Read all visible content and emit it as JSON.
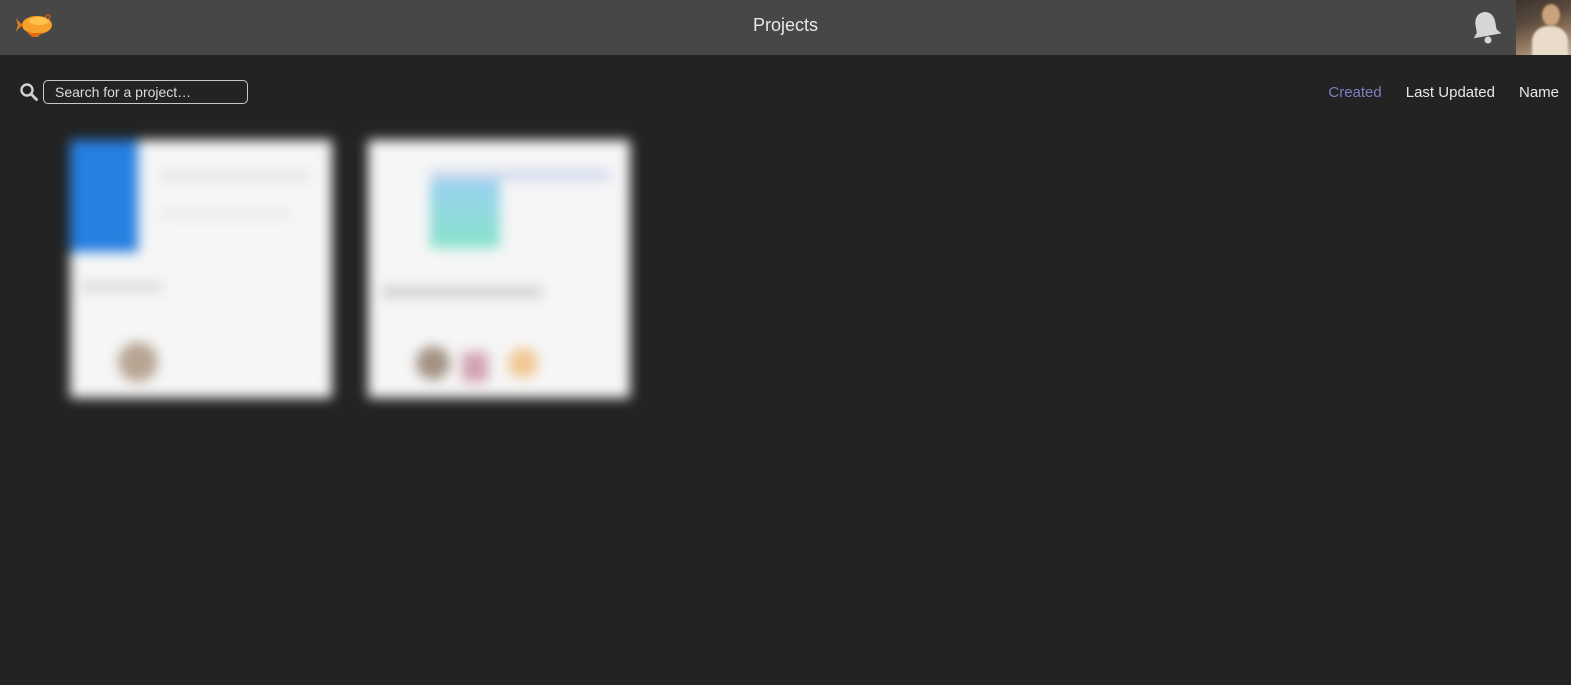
{
  "header": {
    "title": "Projects",
    "logo_icon": "zeppelin-logo-icon",
    "notification_icon": "bell-icon",
    "avatar_icon": "user-avatar"
  },
  "search": {
    "placeholder": "Search for a project…",
    "value": "",
    "icon": "search-icon"
  },
  "sort": {
    "options": [
      "Created",
      "Last Updated",
      "Name"
    ],
    "active": "Created",
    "active_color": "#7a7fbf"
  },
  "projects": [
    {
      "name": "",
      "thumbnail_accent": "#2680e0"
    },
    {
      "name": "",
      "thumbnail_accent": "#8cc8f0"
    }
  ],
  "colors": {
    "topbar": "#474747",
    "background": "#232323"
  }
}
